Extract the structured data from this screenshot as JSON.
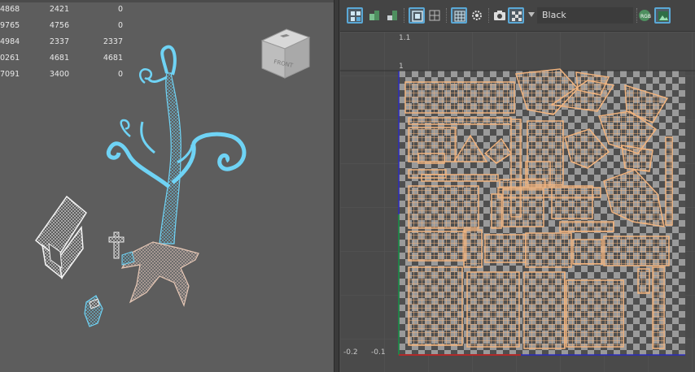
{
  "stats": {
    "rows": [
      [
        "4868",
        "2421",
        "0"
      ],
      [
        "9765",
        "4756",
        "0"
      ],
      [
        "4984",
        "2337",
        "2337"
      ],
      [
        "0261",
        "4681",
        "4681"
      ],
      [
        "7091",
        "3400",
        "0"
      ]
    ]
  },
  "view_cube": {
    "face_label": "FRONT"
  },
  "uv_editor": {
    "background_color_value": "Black",
    "axis_labels": {
      "v_1_1": "1.1",
      "v_1": "1",
      "u_neg_0_2": "-0.2",
      "u_neg_0_1": "-0.1"
    }
  },
  "colors": {
    "viewport_bg": "#5d5d5d",
    "uv_shell_fill": "#f0b37e",
    "wire_selected": "#6fd3f5",
    "wire_white": "#f4f4f4",
    "active_button_border": "#5aa8d6"
  },
  "icons": [
    "uv-shell-icon",
    "uv-component-icon",
    "uv-flip-icon",
    "grid-display-icon",
    "grid-snap-icon",
    "checker-display-icon",
    "uv-distortion-icon",
    "snapshot-icon",
    "texture-checker-icon",
    "rgb-channel-icon",
    "image-display-icon"
  ]
}
